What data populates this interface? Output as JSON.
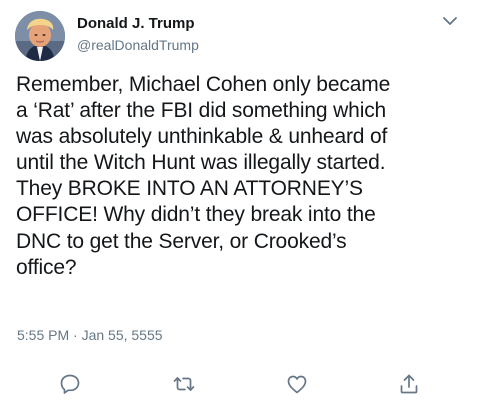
{
  "tweet": {
    "author": {
      "name": "Donald J. Trump",
      "handle": "@realDonaldTrump",
      "avatar_icon": "profile-photo"
    },
    "text_lines": [
      "Remember, Michael Cohen only became",
      "a ‘Rat’ after the FBI did something which",
      "was absolutely unthinkable & unheard of",
      "until the Witch Hunt was illegally started.",
      "They BROKE INTO AN ATTORNEY’S",
      "OFFICE! Why didn’t they break into the",
      "DNC to get the Server, or Crooked’s",
      "office?"
    ],
    "timestamp": "5:55 PM · Jan 55, 5555"
  },
  "menu": {
    "icon": "chevron-down-icon"
  },
  "actions": [
    {
      "icon": "reply-icon"
    },
    {
      "icon": "retweet-icon"
    },
    {
      "icon": "like-icon"
    },
    {
      "icon": "share-icon"
    }
  ],
  "colors": {
    "text": "#14171a",
    "secondary": "#657786",
    "icon": "#657786",
    "background": "#ffffff"
  }
}
